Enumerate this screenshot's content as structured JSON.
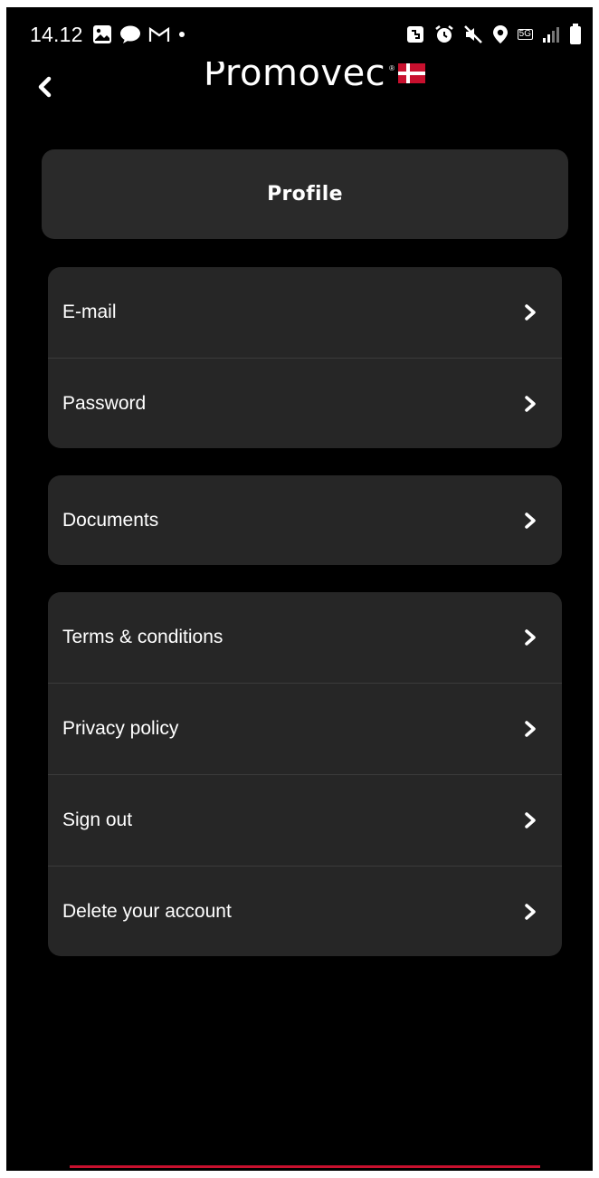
{
  "status_bar": {
    "time": "14.12",
    "left_icons": [
      "gallery-icon",
      "chat-icon",
      "gmail-icon",
      "dot-icon"
    ],
    "right_icons": [
      "nfc-icon",
      "alarm-icon",
      "mute-icon",
      "location-icon",
      "network-5g-icon",
      "signal-icon",
      "battery-icon"
    ],
    "network_label": "5G"
  },
  "header": {
    "back_icon": "chevron-left-icon",
    "logo_text": "Promovec",
    "logo_mark": "®"
  },
  "page": {
    "title": "Profile"
  },
  "groups": [
    {
      "items": [
        {
          "label": "E-mail"
        },
        {
          "label": "Password"
        }
      ]
    },
    {
      "items": [
        {
          "label": "Documents"
        }
      ]
    },
    {
      "items": [
        {
          "label": "Terms & conditions"
        },
        {
          "label": "Privacy policy"
        },
        {
          "label": "Sign out"
        },
        {
          "label": "Delete your account"
        }
      ]
    }
  ],
  "colors": {
    "background": "#000000",
    "card": "#262626",
    "title_card": "#2a2a2a",
    "divider": "#3b3b3b",
    "accent_red": "#c8102e",
    "text": "#ffffff"
  }
}
